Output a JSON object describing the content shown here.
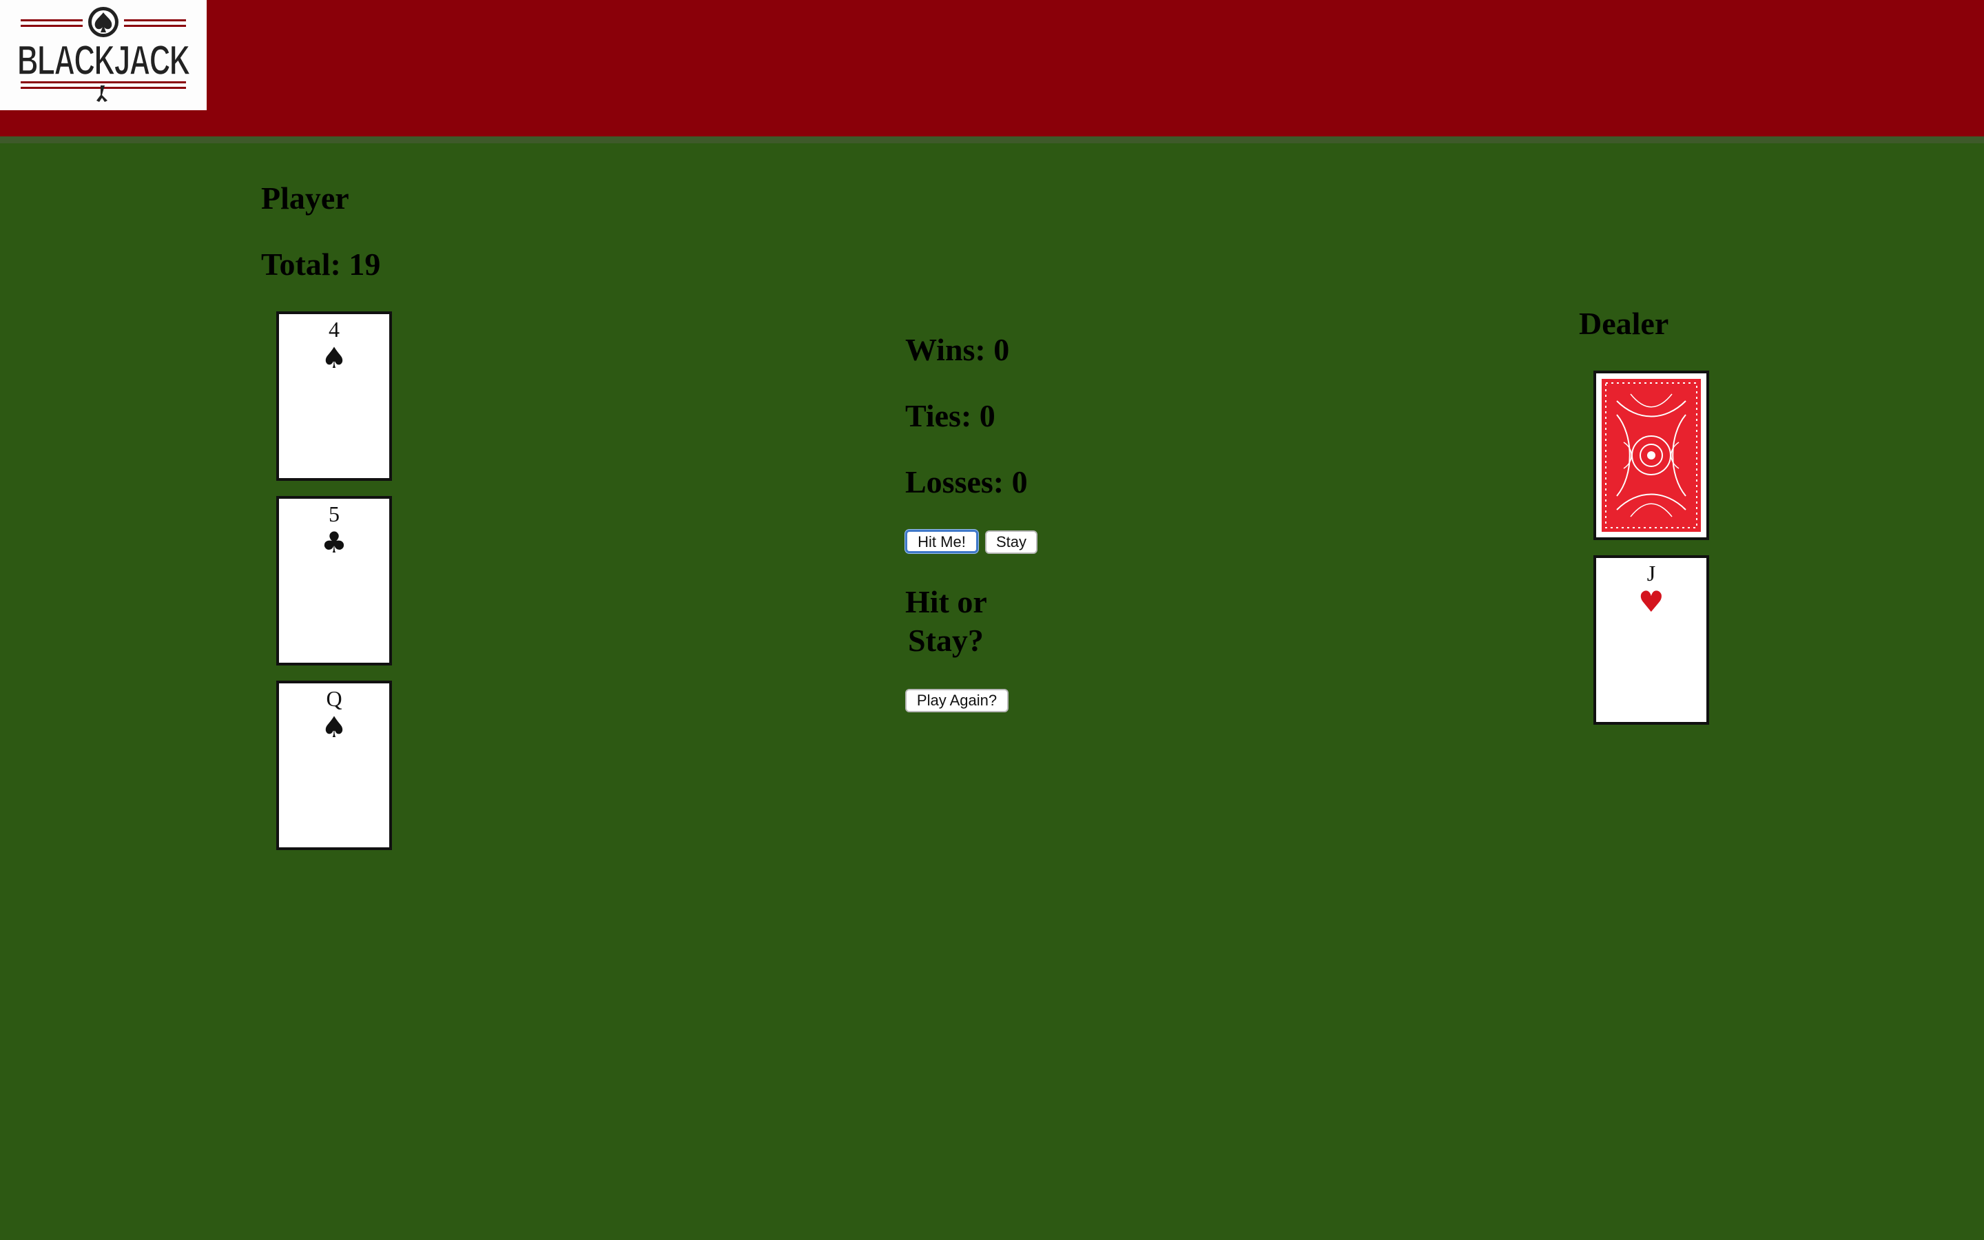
{
  "app": {
    "logo_text": "BLACKJACK"
  },
  "player": {
    "title": "Player",
    "total_label": "Total: 19",
    "cards": [
      {
        "rank": "4",
        "suit": "♠",
        "suit_color": "#111111"
      },
      {
        "rank": "5",
        "suit": "♣",
        "suit_color": "#111111"
      },
      {
        "rank": "Q",
        "suit": "♠",
        "suit_color": "#111111"
      }
    ]
  },
  "dealer": {
    "title": "Dealer",
    "hidden_card": "card-back",
    "cards": [
      {
        "rank": "J",
        "suit": "♥",
        "suit_color": "#d4141e"
      }
    ]
  },
  "scoreboard": {
    "wins": "Wins: 0",
    "ties": "Ties: 0",
    "losses": "Losses: 0"
  },
  "controls": {
    "hit_label": "Hit Me!",
    "stay_label": "Stay",
    "status_line1": "Hit or",
    "status_line2": "Stay?",
    "play_again_label": "Play Again?"
  },
  "colors": {
    "header": "#8a0009",
    "table": "#2d5913",
    "card_back": "#e8222e"
  }
}
